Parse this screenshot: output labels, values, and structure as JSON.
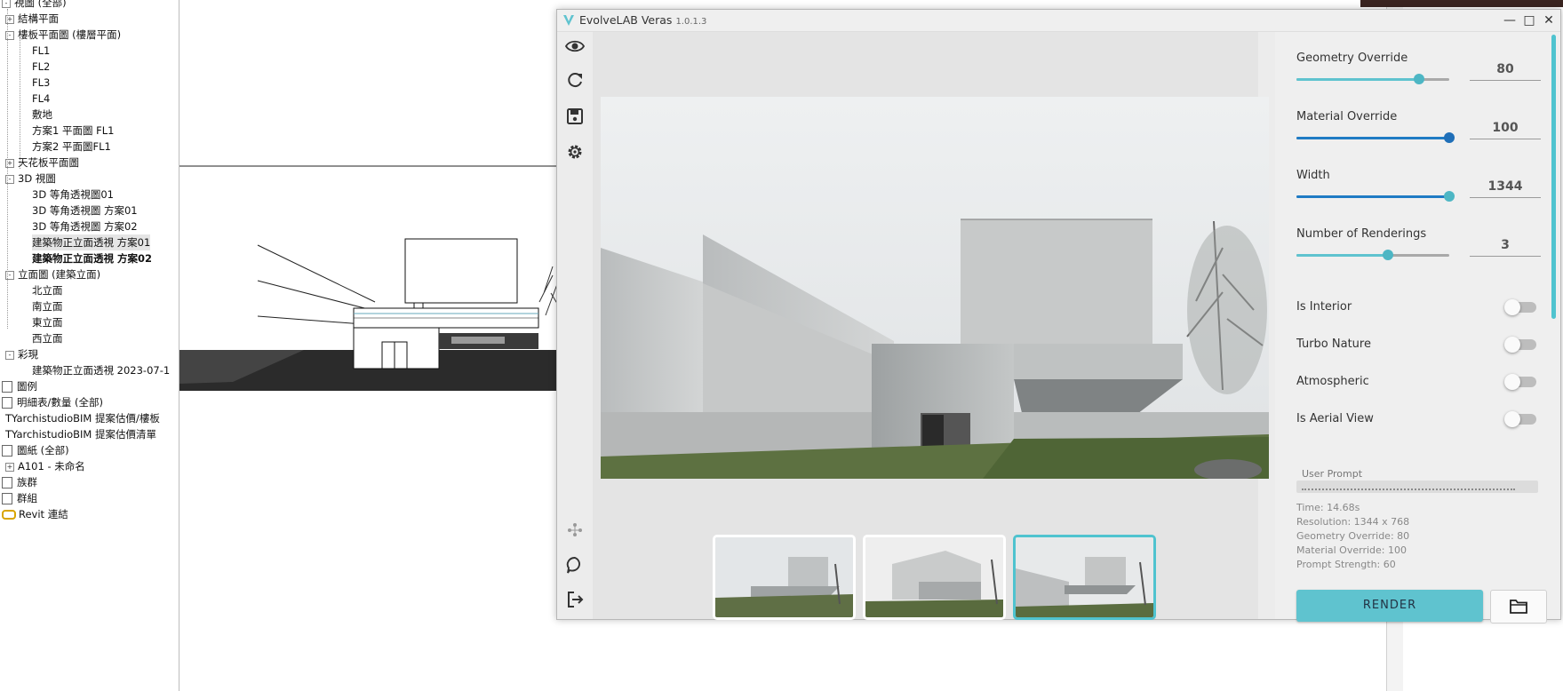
{
  "browser": {
    "items": [
      {
        "label": "視圖 (全部)",
        "level": 0,
        "toggle": "-"
      },
      {
        "label": "結構平面",
        "level": 1,
        "toggle": "+"
      },
      {
        "label": "樓板平面圖 (樓層平面)",
        "level": 1,
        "toggle": "-"
      },
      {
        "label": "FL1",
        "level": 2
      },
      {
        "label": "FL2",
        "level": 2
      },
      {
        "label": "FL3",
        "level": 2
      },
      {
        "label": "FL4",
        "level": 2
      },
      {
        "label": "敷地",
        "level": 2
      },
      {
        "label": "方案1 平面圖 FL1",
        "level": 2
      },
      {
        "label": "方案2 平面圖FL1",
        "level": 2
      },
      {
        "label": "天花板平面圖",
        "level": 1,
        "toggle": "+"
      },
      {
        "label": "3D 視圖",
        "level": 1,
        "toggle": "-"
      },
      {
        "label": "3D 等角透視圖01",
        "level": 2
      },
      {
        "label": "3D 等角透視圖 方案01",
        "level": 2
      },
      {
        "label": "3D 等角透視圖 方案02",
        "level": 2
      },
      {
        "label": "建築物正立面透視 方案01",
        "level": 2,
        "selected": true
      },
      {
        "label": "建築物正立面透視 方案02",
        "level": 2,
        "bold": true
      },
      {
        "label": "立面圖 (建築立面)",
        "level": 1,
        "toggle": "-"
      },
      {
        "label": "北立面",
        "level": 2
      },
      {
        "label": "南立面",
        "level": 2
      },
      {
        "label": "東立面",
        "level": 2
      },
      {
        "label": "西立面",
        "level": 2
      },
      {
        "label": "彩現",
        "level": 1,
        "toggle": "-"
      },
      {
        "label": "建築物正立面透視 2023-07-1",
        "level": 2
      },
      {
        "label": "圖例",
        "level": 0,
        "icon": "legend"
      },
      {
        "label": "明細表/數量 (全部)",
        "level": 0,
        "icon": "schedule"
      },
      {
        "label": "TYarchistudioBIM 提案估價/樓板",
        "level": 1
      },
      {
        "label": "TYarchistudioBIM 提案估價清單",
        "level": 1
      },
      {
        "label": "圖紙 (全部)",
        "level": 0,
        "icon": "sheet"
      },
      {
        "label": "A101 - 未命名",
        "level": 1,
        "toggle": "+"
      },
      {
        "label": "族群",
        "level": 0,
        "icon": "family"
      },
      {
        "label": "群組",
        "level": 0,
        "icon": "group"
      },
      {
        "label": "Revit 連結",
        "level": 0,
        "icon": "link"
      }
    ]
  },
  "veras": {
    "title": "EvolveLAB Veras",
    "version": "1.0.1.3",
    "toolbar": [
      {
        "name": "eye-icon"
      },
      {
        "name": "refresh-icon"
      },
      {
        "name": "save-icon"
      },
      {
        "name": "gear-icon"
      },
      {
        "name": "nodes-icon"
      },
      {
        "name": "chat-icon"
      },
      {
        "name": "exit-icon"
      }
    ],
    "sliders": [
      {
        "label": "Geometry Override",
        "value": "80",
        "fraction": 0.8
      },
      {
        "label": "Material Override",
        "value": "100",
        "fraction": 1.0
      },
      {
        "label": "Width",
        "value": "1344",
        "fraction": 1.0
      },
      {
        "label": "Number of Renderings",
        "value": "3",
        "fraction": 0.6
      }
    ],
    "toggles": [
      {
        "label": "Is Interior",
        "on": false
      },
      {
        "label": "Turbo Nature",
        "on": false
      },
      {
        "label": "Atmospheric",
        "on": false
      },
      {
        "label": "Is Aerial View",
        "on": false
      }
    ],
    "prompt_label": "User Prompt",
    "info": {
      "time": "Time: 14.68s",
      "resolution": "Resolution: 1344 x 768",
      "geometry": "Geometry Override: 80",
      "material": "Material Override: 100",
      "prompt_strength": "Prompt Strength: 60"
    },
    "render_label": "RENDER",
    "selected_thumbnail": 2,
    "accent_color": "#5fc3cf"
  }
}
